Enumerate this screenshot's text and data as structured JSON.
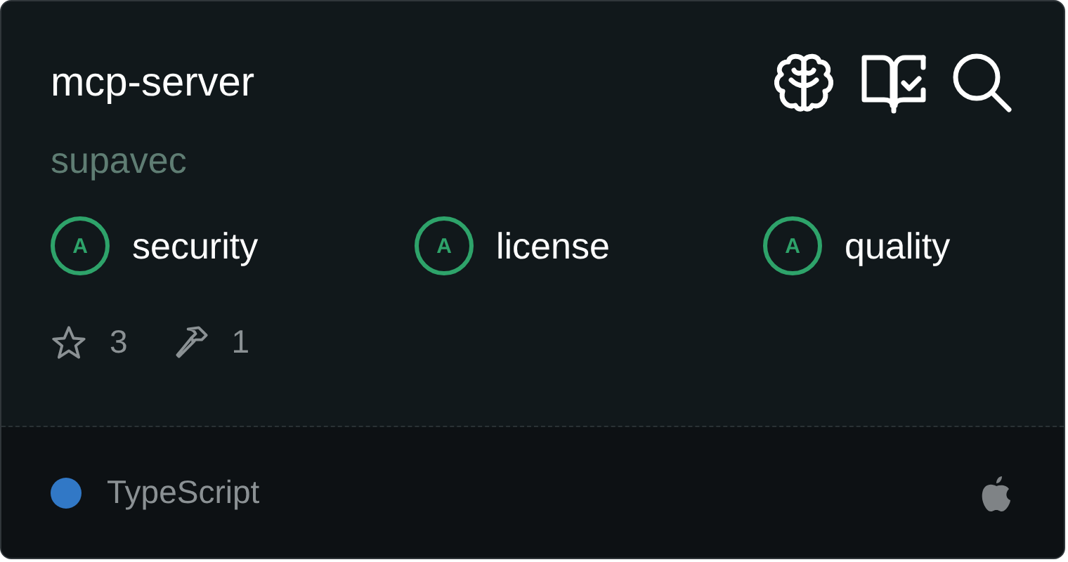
{
  "title": "mcp-server",
  "owner": "supavec",
  "scores": [
    {
      "grade": "A",
      "label": "security"
    },
    {
      "grade": "A",
      "label": "license"
    },
    {
      "grade": "A",
      "label": "quality"
    }
  ],
  "stats": {
    "stars": "3",
    "tools": "1"
  },
  "footer": {
    "language": "TypeScript",
    "color": "#3178c6"
  }
}
